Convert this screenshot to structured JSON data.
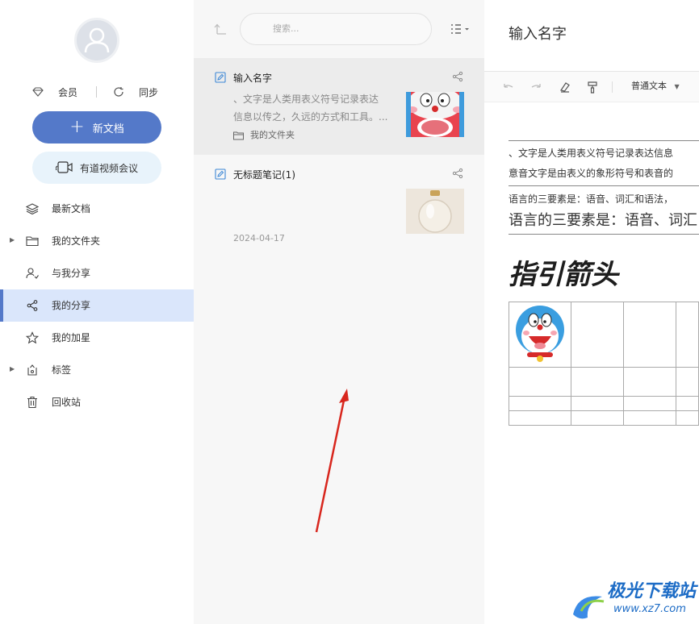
{
  "sidebar": {
    "vip_label": "会员",
    "sync_label": "同步",
    "new_doc_label": "新文档",
    "meeting_label": "有道视频会议",
    "nav": [
      {
        "label": "最新文档",
        "icon": "layers-icon"
      },
      {
        "label": "我的文件夹",
        "icon": "folder-icon",
        "expandable": true
      },
      {
        "label": "与我分享",
        "icon": "shared-users-icon"
      },
      {
        "label": "我的分享",
        "icon": "share-icon",
        "active": true
      },
      {
        "label": "我的加星",
        "icon": "star-icon"
      },
      {
        "label": "标签",
        "icon": "tag-icon",
        "expandable": true
      },
      {
        "label": "回收站",
        "icon": "trash-icon"
      }
    ]
  },
  "list": {
    "search_placeholder": "搜索...",
    "notes": [
      {
        "title": "输入名字",
        "snippet_line1": "、文字是人类用表义符号记录表达",
        "snippet_line2": "信息以传之，久远的方式和工具。...",
        "folder": "我的文件夹",
        "selected": true
      },
      {
        "title": "无标题笔记(1)",
        "date": "2024-04-17",
        "selected": false
      }
    ]
  },
  "editor": {
    "doc_title": "输入名字",
    "style_select": "普通文本",
    "paragraph1_line1": "、文字是人类用表义符号记录表达信息",
    "paragraph1_line2": "意音文字是由表义的象形符号和表音的",
    "paragraph2": "语言的三要素是：语音、词汇和语法，",
    "paragraph3_large": "语言的三要素是：语音、词汇",
    "heading": "指引箭头"
  },
  "watermark": {
    "name": "极光下载站",
    "url": "www.xz7.com"
  },
  "colors": {
    "accent": "#5479c9",
    "active_nav_bg": "#dae6fb",
    "meeting_bg": "#e8f3fb",
    "annotation_arrow": "#d8261d"
  }
}
